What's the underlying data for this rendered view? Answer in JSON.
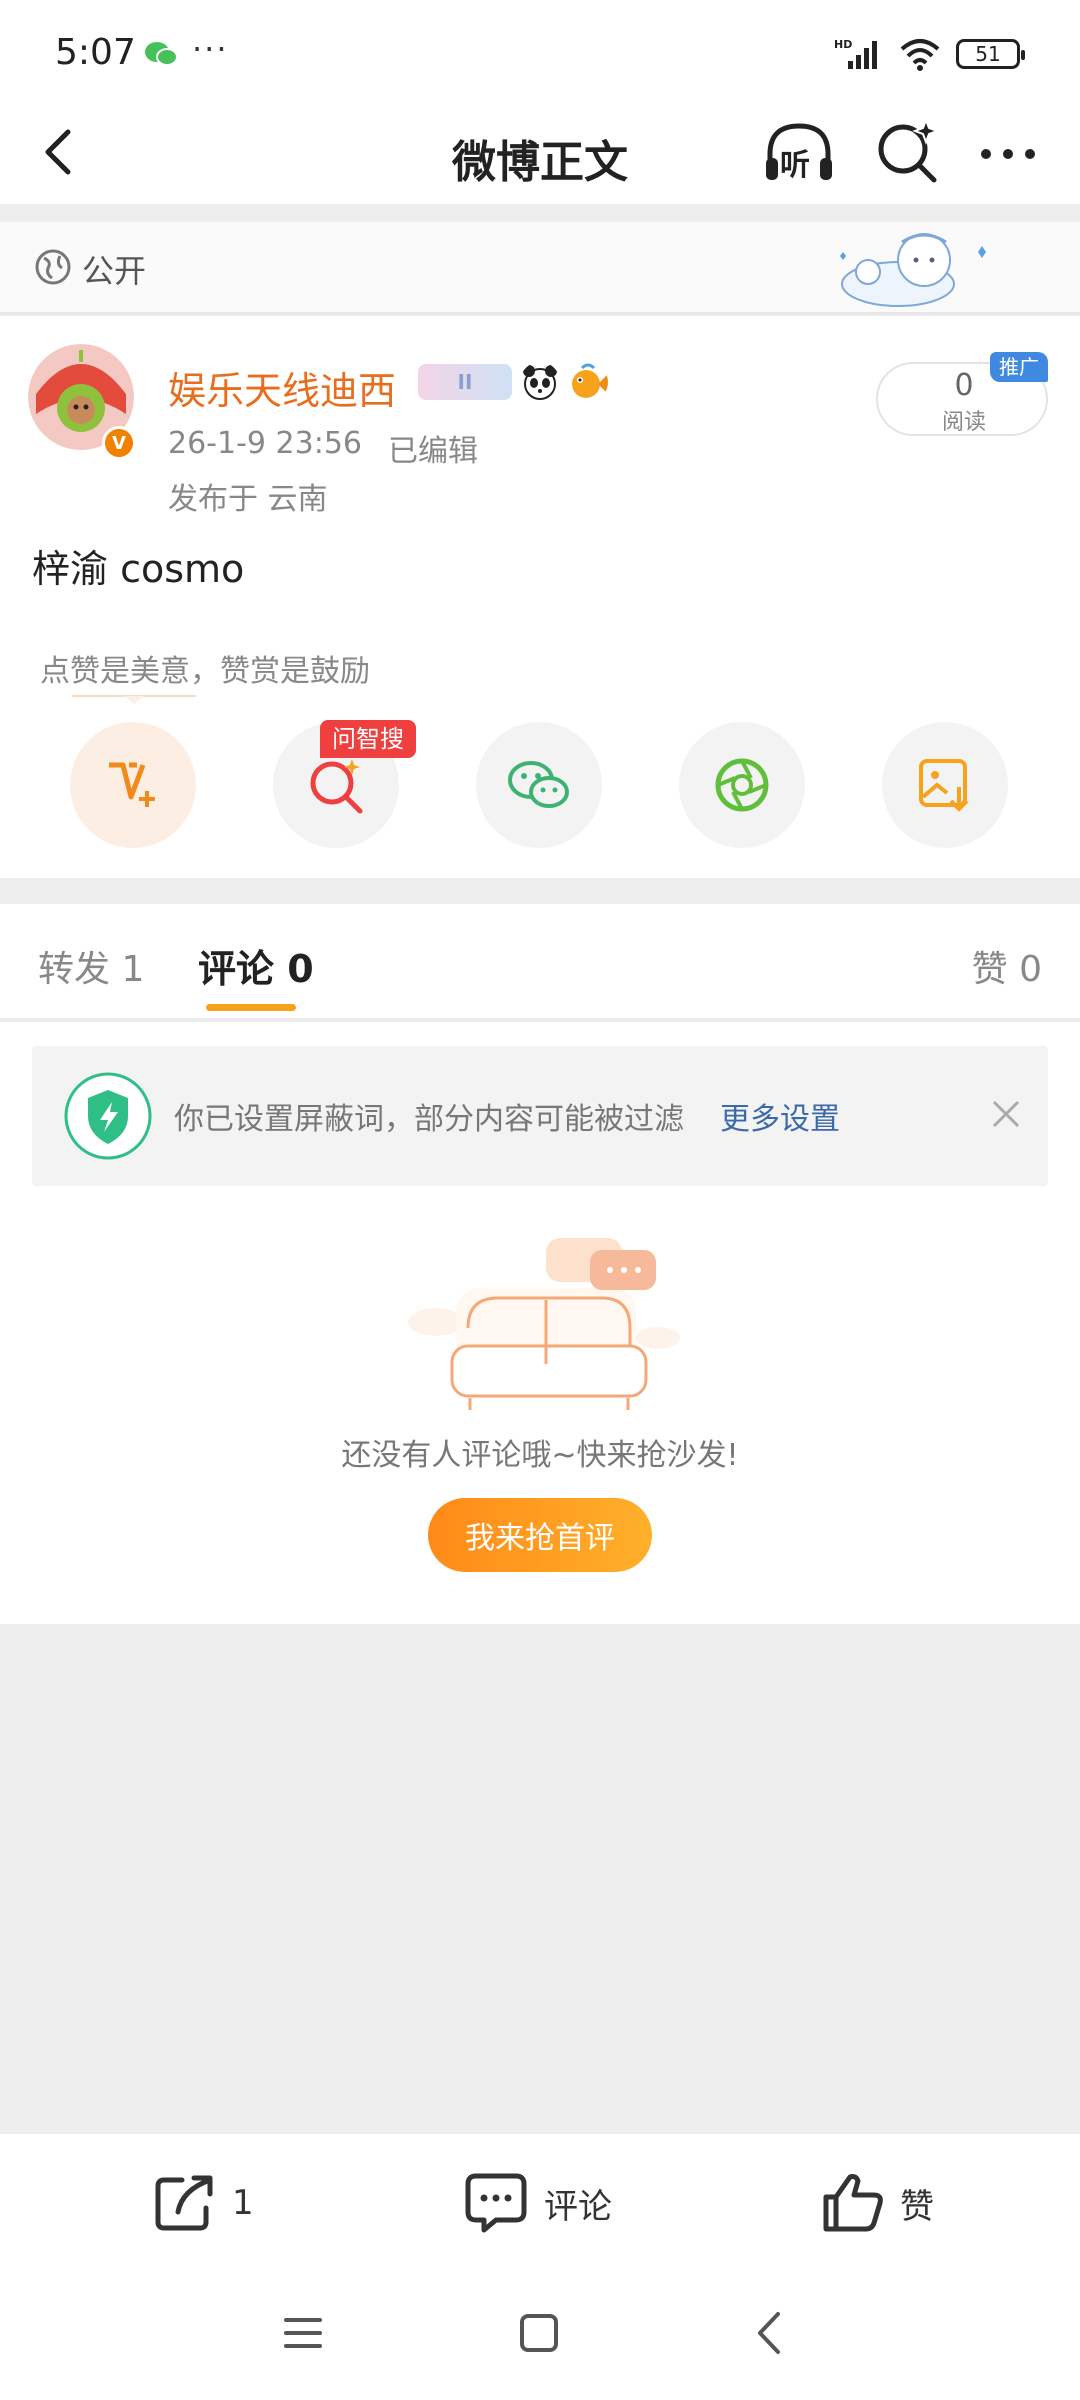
{
  "status_bar": {
    "time": "5:07",
    "battery": "51",
    "more": "···"
  },
  "header": {
    "title": "微博正文",
    "listen_label": "听"
  },
  "visibility": {
    "label": "公开"
  },
  "post": {
    "author": "娱乐天线迪西",
    "verified_mark": "V",
    "vip_badge": "II",
    "time": "26-1-9 23:56",
    "edited": "已编辑",
    "location": "发布于 云南",
    "read_count": "0",
    "read_label": "阅读",
    "promo": "推广",
    "text": "梓渝 cosmo",
    "reward_tip": "点赞是美意，赞赏是鼓励",
    "ask_tag": "问智搜"
  },
  "tabs": {
    "repost": "转发 1",
    "comments": "评论 0",
    "likes": "赞 0"
  },
  "comments": {
    "filter_notice": "你已设置屏蔽词，部分内容可能被过滤",
    "filter_more": "更多设置",
    "empty_text": "还没有人评论哦~快来抢沙发!",
    "first_comment_button": "我来抢首评"
  },
  "toolbar": {
    "repost_count": "1",
    "comment_label": "评论",
    "like_label": "赞"
  },
  "colors": {
    "accent": "#f7a21b",
    "author_name": "#e86e1e",
    "link": "#3a6aa8"
  }
}
